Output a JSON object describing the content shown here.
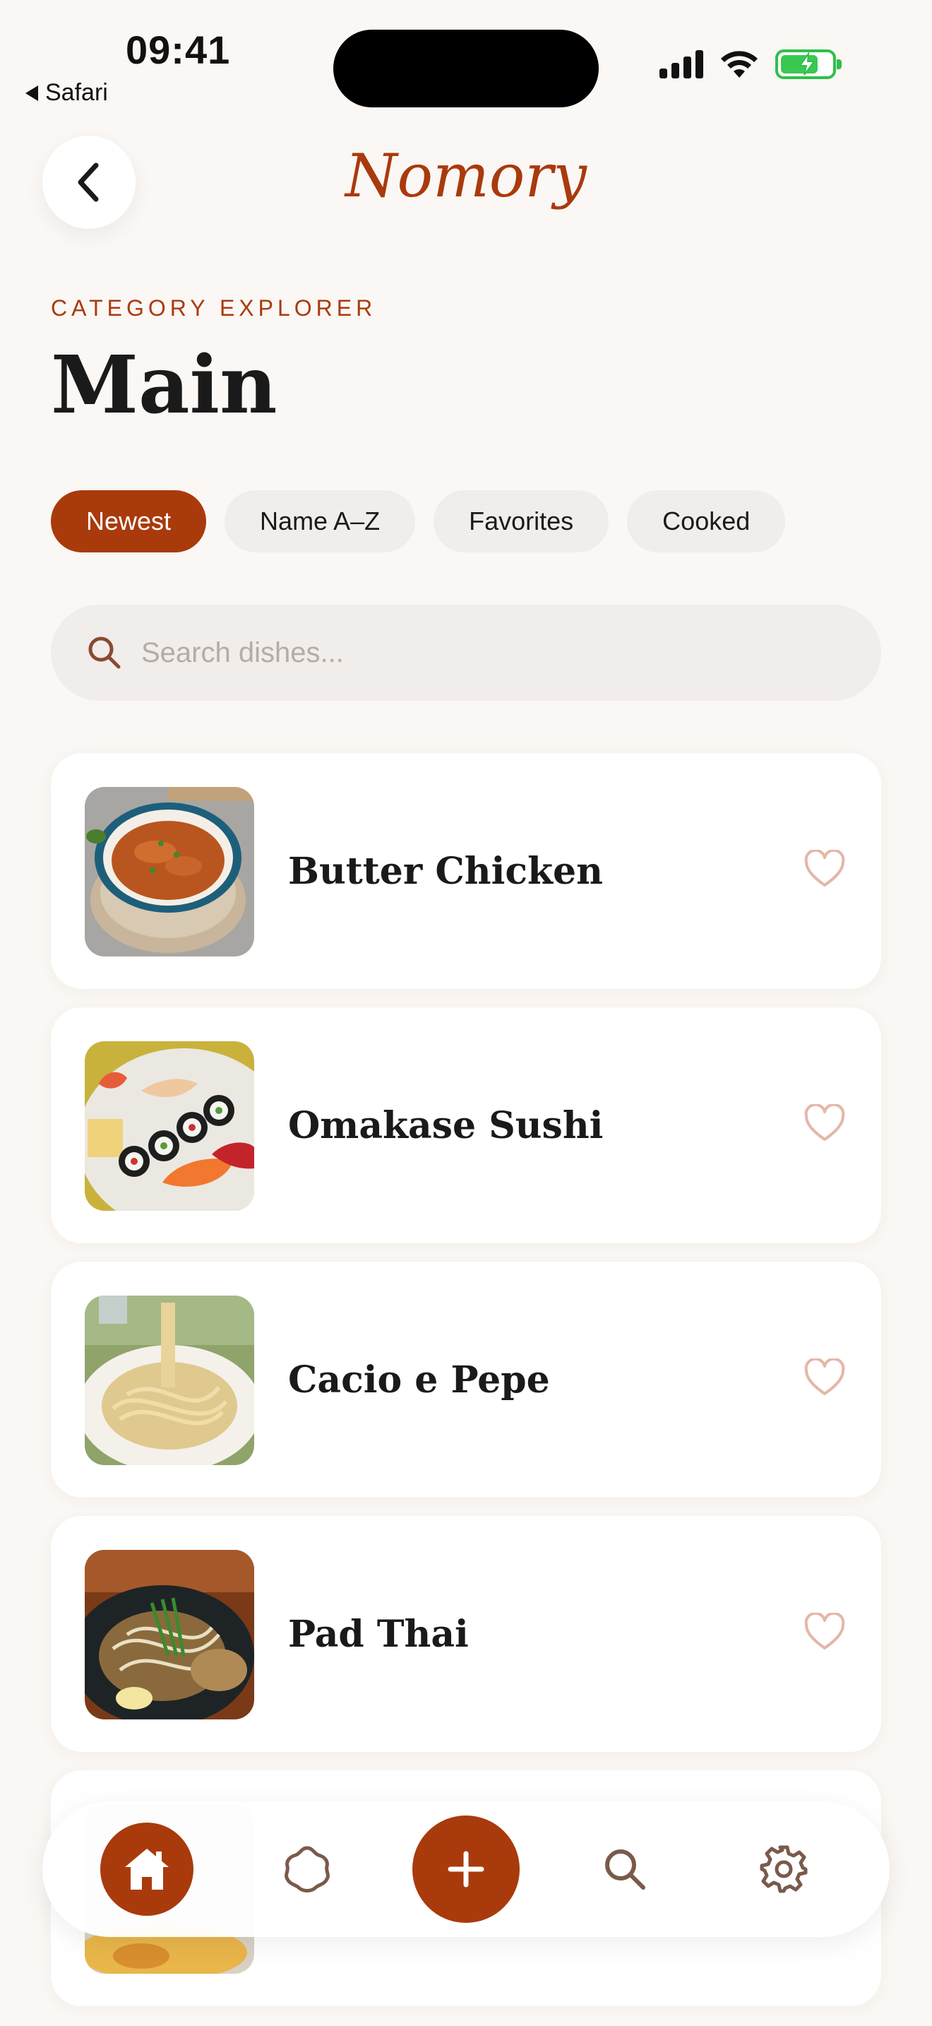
{
  "status": {
    "time": "09:41",
    "back_app": "Safari"
  },
  "header": {
    "app_title": "Nomory"
  },
  "page": {
    "eyebrow": "CATEGORY EXPLORER",
    "title": "Main"
  },
  "filters": [
    {
      "label": "Newest",
      "active": true
    },
    {
      "label": "Name A–Z",
      "active": false
    },
    {
      "label": "Favorites",
      "active": false
    },
    {
      "label": "Cooked",
      "active": false
    }
  ],
  "search": {
    "placeholder": "Search dishes..."
  },
  "dishes": [
    {
      "name": "Butter Chicken",
      "favorite": false
    },
    {
      "name": "Omakase Sushi",
      "favorite": false
    },
    {
      "name": "Cacio e Pepe",
      "favorite": false
    },
    {
      "name": "Pad Thai",
      "favorite": false
    }
  ],
  "nav": {
    "items": [
      "home-icon",
      "badge-icon",
      "plus-icon",
      "search-icon",
      "gear-icon"
    ],
    "active": "home-icon"
  },
  "colors": {
    "accent": "#a93a0c",
    "background": "#faf7f4",
    "chip": "#f1edea",
    "heart": "#e3b7a8"
  }
}
